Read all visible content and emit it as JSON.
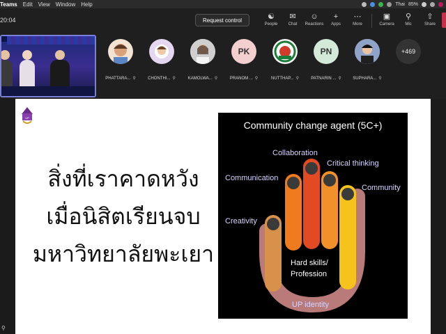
{
  "menubar": {
    "app": "Teams",
    "items": [
      "Edit",
      "View",
      "Window",
      "Help"
    ],
    "language": "Thai",
    "battery": "85%"
  },
  "toolbar": {
    "timer": "20:04",
    "request_control": "Request control",
    "buttons": [
      {
        "label": "People",
        "icon": "people-icon"
      },
      {
        "label": "Chat",
        "icon": "chat-icon"
      },
      {
        "label": "Reactions",
        "icon": "reactions-icon"
      },
      {
        "label": "Apps",
        "icon": "apps-icon"
      },
      {
        "label": "More",
        "icon": "more-icon"
      },
      {
        "label": "Camera",
        "icon": "camera-icon"
      },
      {
        "label": "Mic",
        "icon": "mic-off-icon"
      },
      {
        "label": "Share",
        "icon": "share-icon"
      }
    ]
  },
  "participants": [
    {
      "name": "PHATTARA...",
      "initials": "",
      "color": "#f3e3d2"
    },
    {
      "name": "CHONTHI...",
      "initials": "",
      "color": "#e6d7f0"
    },
    {
      "name": "KAMOLWA...",
      "initials": "",
      "color": "#d8d8d8"
    },
    {
      "name": "PRANOM ...",
      "initials": "PK",
      "color": "#f4cfcf"
    },
    {
      "name": "NUTTHAP...",
      "initials": "",
      "color": "#f6f6f6"
    },
    {
      "name": "PATNARIN ...",
      "initials": "PN",
      "color": "#d4ead9"
    },
    {
      "name": "SUPHARA...",
      "initials": "",
      "color": "#c9c9d8"
    }
  ],
  "overflow_count": "+469",
  "slide": {
    "thai_lines": [
      "สิ่งที่เราคาดหวัง",
      "เมื่อนิสิตเรียนจบ",
      "มหาวิทยาลัยพะเยา"
    ],
    "logo_text": "UP",
    "panel": {
      "title": "Community change agent (5C+)",
      "labels": {
        "collaboration": "Collaboration",
        "critical": "Critical thinking",
        "communication": "Communication",
        "community": "Community",
        "creativity": "Creativity",
        "hard_skills_1": "Hard skills/",
        "hard_skills_2": "Profession",
        "identity": "UP identity"
      }
    }
  },
  "colors": {
    "finger_creativity": "#d8914a",
    "finger_communication": "#f07a1e",
    "finger_collaboration": "#e24a23",
    "finger_critical": "#f2912a",
    "finger_community": "#f6c21c",
    "palm": "#b97a7a"
  }
}
